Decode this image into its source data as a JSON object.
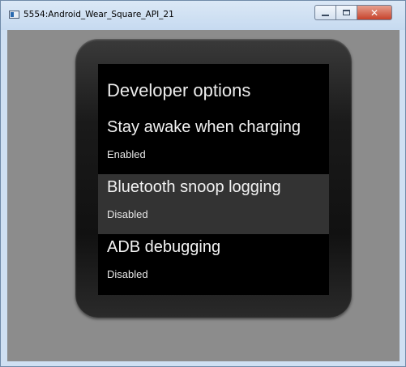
{
  "window": {
    "title": "5554:Android_Wear_Square_API_21",
    "controls": {
      "minimize_icon": "minimize-icon",
      "maximize_icon": "maximize-icon",
      "close_icon": "close-icon",
      "close_label": "✕"
    }
  },
  "screen": {
    "title": "Developer options",
    "options": [
      {
        "title": "Stay awake when charging",
        "status": "Enabled",
        "selected": false
      },
      {
        "title": "Bluetooth snoop logging",
        "status": "Disabled",
        "selected": true
      },
      {
        "title": "ADB debugging",
        "status": "Disabled",
        "selected": false
      }
    ]
  },
  "colors": {
    "emulator_background": "#8c8c8c",
    "screen_background": "#000000",
    "selected_row": "#333333",
    "close_button": "#c7432b"
  }
}
